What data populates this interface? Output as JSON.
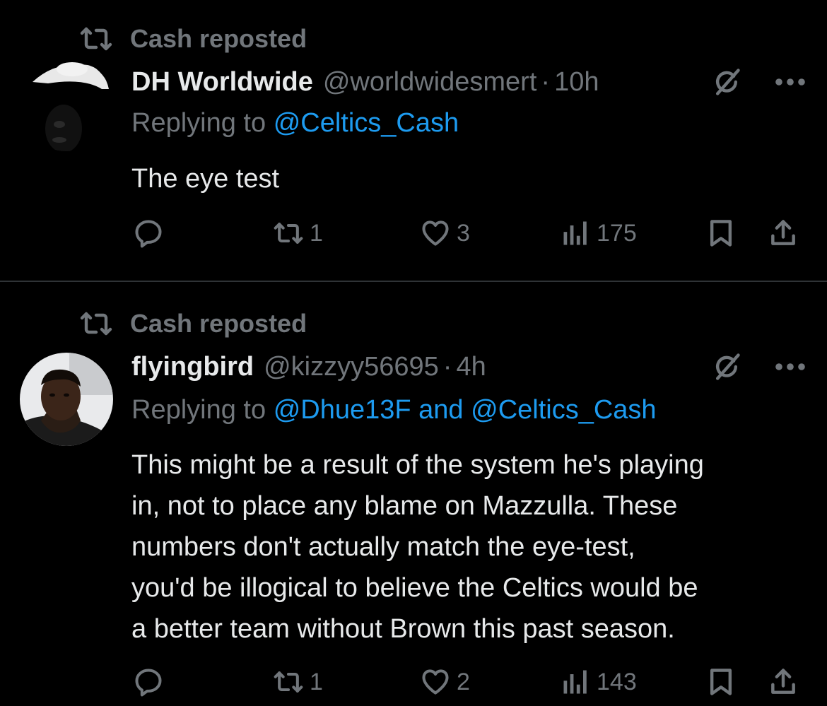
{
  "tweets": [
    {
      "repost_label": "Cash reposted",
      "display_name": "DH Worldwide",
      "handle": "@worldwidesmert",
      "separator": "·",
      "time": "10h",
      "replying_prefix": "Replying to",
      "replying_to": [
        "@Celtics_Cash"
      ],
      "replying_joiner": "",
      "text": "The eye test",
      "reply_count": "",
      "repost_count": "1",
      "like_count": "3",
      "view_count": "175"
    },
    {
      "repost_label": "Cash reposted",
      "display_name": "flyingbird",
      "handle": "@kizzyy56695",
      "separator": "·",
      "time": "4h",
      "replying_prefix": "Replying to",
      "replying_to": [
        "@Dhue13F",
        "@Celtics_Cash"
      ],
      "replying_joiner": "and",
      "text_lines": [
        "This might be a result of the system he's playing",
        "in, not to place any blame on Mazzulla. These",
        "numbers don't actually match the eye-test,",
        "you'd be illogical to believe the Celtics would be",
        "a better team without Brown this past season."
      ],
      "reply_count": "",
      "repost_count": "1",
      "like_count": "2",
      "view_count": "143"
    }
  ],
  "icons": {
    "repost": "repost-icon",
    "reply": "reply-icon",
    "like": "heart-icon",
    "views": "views-icon",
    "bookmark": "bookmark-icon",
    "share": "share-icon",
    "grok": "grok-icon",
    "more": "more-icon"
  },
  "colors": {
    "background": "#000000",
    "text": "#e7e9ea",
    "muted": "#71767b",
    "link": "#1d9bf0",
    "divider": "#2f3336"
  }
}
